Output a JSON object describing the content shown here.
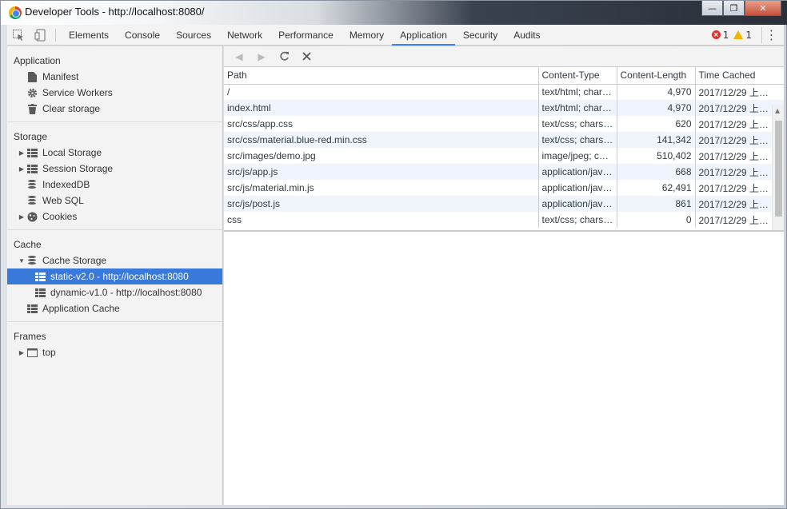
{
  "window": {
    "title": "Developer Tools - http://localhost:8080/",
    "minimize": "—",
    "maximize": "❐",
    "close": "✕"
  },
  "toolbar": {
    "tabs": [
      "Elements",
      "Console",
      "Sources",
      "Network",
      "Performance",
      "Memory",
      "Application",
      "Security",
      "Audits"
    ],
    "active_tab": "Application",
    "errors": "1",
    "warnings": "1"
  },
  "sidebar": {
    "application": {
      "title": "Application",
      "items": [
        "Manifest",
        "Service Workers",
        "Clear storage"
      ]
    },
    "storage": {
      "title": "Storage",
      "items": [
        "Local Storage",
        "Session Storage",
        "IndexedDB",
        "Web SQL",
        "Cookies"
      ]
    },
    "cache": {
      "title": "Cache",
      "cache_storage": "Cache Storage",
      "entries": [
        "static-v2.0 - http://localhost:8080",
        "dynamic-v1.0 - http://localhost:8080"
      ],
      "selected": "static-v2.0 - http://localhost:8080",
      "application_cache": "Application Cache"
    },
    "frames": {
      "title": "Frames",
      "items": [
        "top"
      ]
    }
  },
  "table": {
    "columns": [
      "Path",
      "Content-Type",
      "Content-Length",
      "Time Cached"
    ],
    "rows": [
      [
        "/",
        "text/html; char…",
        "4,970",
        "2017/12/29 上…"
      ],
      [
        "index.html",
        "text/html; char…",
        "4,970",
        "2017/12/29 上…"
      ],
      [
        "src/css/app.css",
        "text/css; charse…",
        "620",
        "2017/12/29 上…"
      ],
      [
        "src/css/material.blue-red.min.css",
        "text/css; charse…",
        "141,342",
        "2017/12/29 上…"
      ],
      [
        "src/images/demo.jpg",
        "image/jpeg; ch…",
        "510,402",
        "2017/12/29 上…"
      ],
      [
        "src/js/app.js",
        "application/jav…",
        "668",
        "2017/12/29 上…"
      ],
      [
        "src/js/material.min.js",
        "application/jav…",
        "62,491",
        "2017/12/29 上…"
      ],
      [
        "src/js/post.js",
        "application/jav…",
        "861",
        "2017/12/29 上…"
      ],
      [
        "css",
        "text/css; charse…",
        "0",
        "2017/12/29 上…"
      ]
    ]
  }
}
